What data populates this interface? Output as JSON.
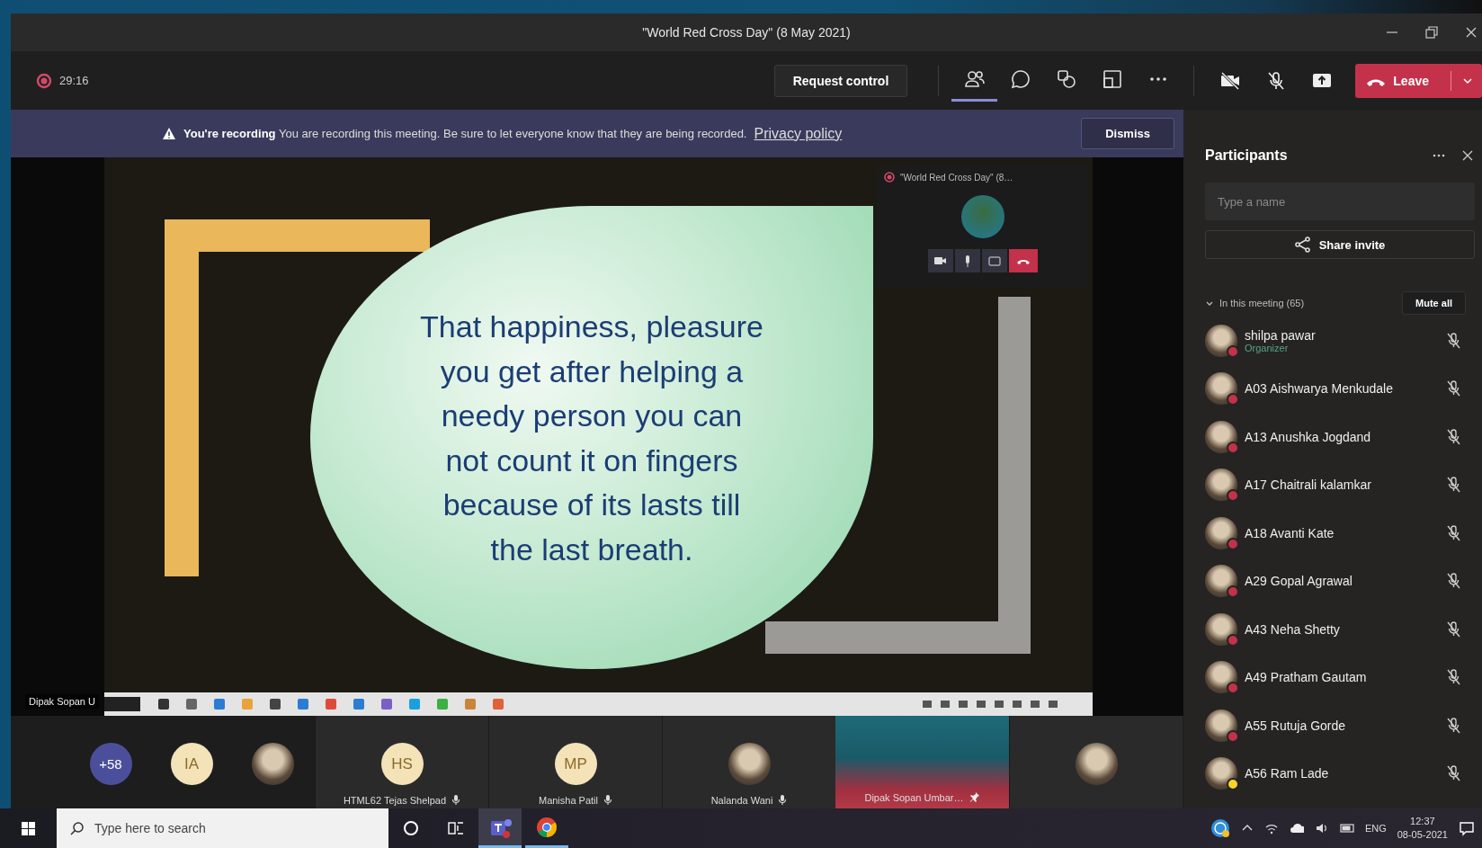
{
  "window": {
    "title": "\"World Red Cross Day\" (8 May 2021)"
  },
  "toolbar": {
    "timer": "29:16",
    "request_control": "Request control",
    "tools": [
      {
        "kind": "people",
        "selected": true
      },
      {
        "kind": "chat",
        "selected": false
      },
      {
        "kind": "apps",
        "selected": false
      },
      {
        "kind": "rooms",
        "selected": false
      },
      {
        "kind": "more",
        "selected": false
      }
    ],
    "leave": "Leave"
  },
  "banner": {
    "title": "You're recording",
    "message": "You are recording this meeting. Be sure to let everyone know that they are being recorded.",
    "link": "Privacy policy",
    "dismiss": "Dismiss"
  },
  "stage": {
    "slide_lines": [
      "That happiness, pleasure",
      "you get after helping a",
      "needy person you can",
      "not count it on fingers",
      "because of its lasts till",
      "the last breath."
    ],
    "mini_window_title": "\"World Red Cross Day\" (8…",
    "presenter": "Dipak Sopan U"
  },
  "gallery": [
    {
      "kind": "count",
      "text": "+58"
    },
    {
      "kind": "avatar",
      "initials": "IA"
    },
    {
      "kind": "avatar"
    },
    {
      "kind": "tile",
      "initials": "HS",
      "name": "HTML62 Tejas Shelpad"
    },
    {
      "kind": "tile",
      "initials": "MP",
      "name": "Manisha Patil"
    },
    {
      "kind": "tile",
      "name": "Nalanda Wani"
    },
    {
      "kind": "video",
      "name": "Dipak Sopan Umbar…"
    },
    {
      "kind": "tile"
    }
  ],
  "participants": {
    "title": "Participants",
    "search": {
      "placeholder": "Type a name"
    },
    "share_invite": "Share invite",
    "section": {
      "label": "In this meeting (65)",
      "expanded": true
    },
    "mute_all": "Mute all",
    "people": [
      {
        "name": "shilpa pawar",
        "role": "Organizer",
        "color": "#c4314b"
      },
      {
        "name": "A03 Aishwarya Menkudale",
        "color": "#c4314b"
      },
      {
        "name": "A13 Anushka Jogdand",
        "color": "#c4314b"
      },
      {
        "name": "A17 Chaitrali kalamkar",
        "color": "#c4314b"
      },
      {
        "name": "A18 Avanti Kate",
        "color": "#c4314b"
      },
      {
        "name": "A29 Gopal Agrawal",
        "color": "#c4314b"
      },
      {
        "name": "A43 Neha Shetty",
        "color": "#c4314b"
      },
      {
        "name": "A49 Pratham Gautam",
        "color": "#c4314b"
      },
      {
        "name": "A55 Rutuja Gorde",
        "color": "#c4314b"
      },
      {
        "name": "A56 Ram Lade",
        "color": "#f8d22a"
      }
    ]
  },
  "taskbar": {
    "search": {
      "placeholder": "Type here to search"
    },
    "apps": [
      {
        "kind": "teams",
        "selected": true
      },
      {
        "kind": "chrome",
        "selected": false
      }
    ],
    "language": "ENG",
    "time": "12:37",
    "date": "08-05-2021"
  }
}
